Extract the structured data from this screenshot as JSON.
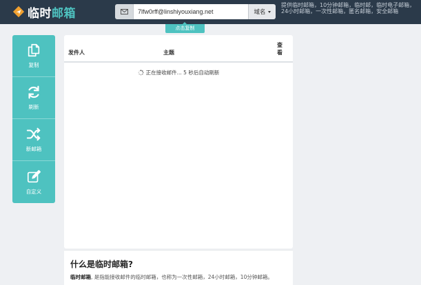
{
  "header": {
    "logo_text_main": "临时",
    "logo_text_accent": "邮箱",
    "email_value": "7lfw0rff@linshiyouxiang.net",
    "domain_button_label": "域名",
    "copy_tip": "点击复制",
    "promo_text": "提供临时邮箱，10分钟邮箱，临时邮，临时电子邮箱，24小时邮箱，一次性邮箱，匿名邮箱，安全邮箱"
  },
  "sidebar": {
    "items": [
      {
        "label": "复制",
        "icon": "copy-icon"
      },
      {
        "label": "刷新",
        "icon": "refresh-icon"
      },
      {
        "label": "新邮箱",
        "icon": "shuffle-icon"
      },
      {
        "label": "自定义",
        "icon": "edit-icon"
      }
    ]
  },
  "inbox": {
    "col_sender": "发件人",
    "col_subject": "主题",
    "col_view": "查看",
    "loading_text": "正在接收邮件... 5 秒后自动刷新"
  },
  "about": {
    "title": "什么是临时邮箱?",
    "text_bold": "临时邮箱",
    "text_rest": ", 是指能接收邮件的临时邮箱，也称为一次性邮箱，24小时邮箱，10分钟邮箱。"
  },
  "colors": {
    "accent": "#4ec2c0",
    "topbar": "#2b3a4a",
    "logo_icon": "#f0a030"
  }
}
